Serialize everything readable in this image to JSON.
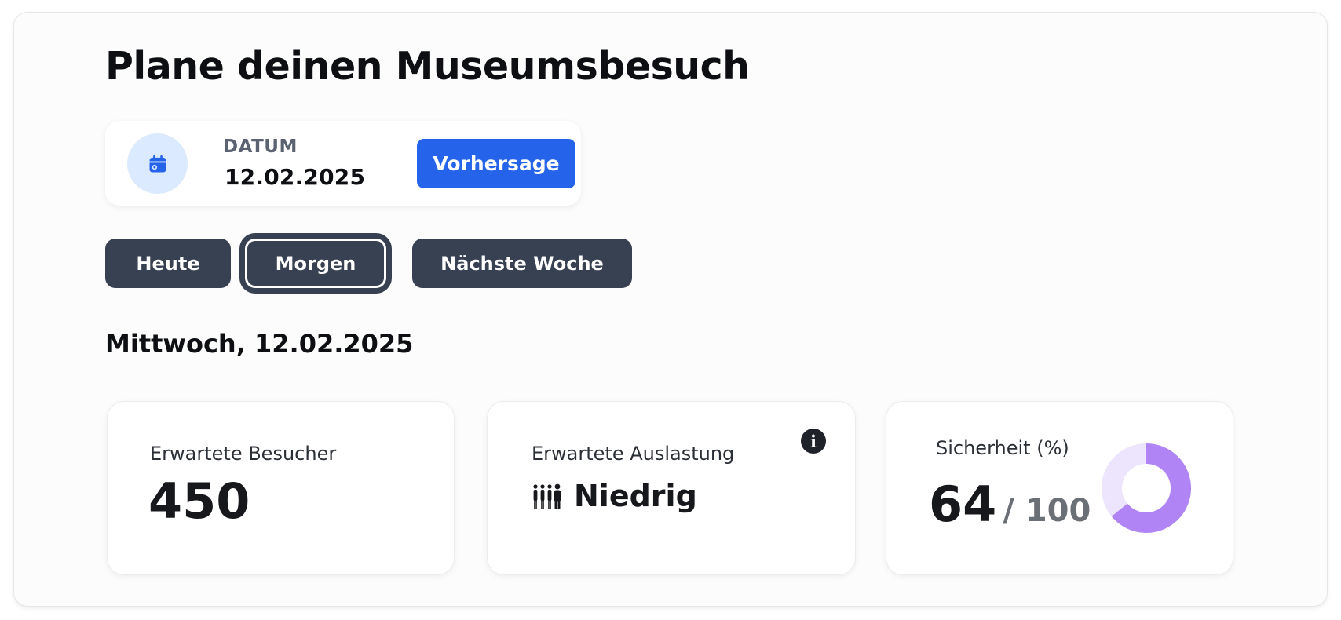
{
  "page": {
    "title": "Plane deinen Museumsbesuch"
  },
  "date_picker": {
    "label": "DATUM",
    "value": "12.02.2025",
    "icon": "calendar-icon",
    "forecast_button": "Vorhersage"
  },
  "quick_select": {
    "today": "Heute",
    "tomorrow": "Morgen",
    "next_week": "Nächste Woche",
    "selected": "Morgen"
  },
  "result": {
    "day_heading": "Mittwoch, 12.02.2025",
    "visitors": {
      "label": "Erwartete Besucher",
      "value": "450"
    },
    "load": {
      "label": "Erwartete Auslastung",
      "value": "Niedrig",
      "icon": "people-icon",
      "info_icon": "info-icon"
    },
    "certainty": {
      "label": "Sicherheit (%)",
      "value": "64",
      "max": "/ 100",
      "percent": 64
    }
  },
  "colors": {
    "accent_blue": "#2563eb",
    "button_dark": "#374151",
    "donut_fill": "#b084f5",
    "donut_track": "#ede4fd",
    "icon_bg": "#dbeafe"
  }
}
